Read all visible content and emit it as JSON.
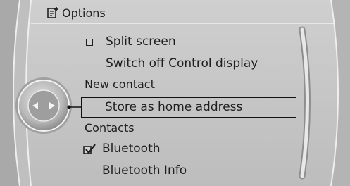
{
  "header": {
    "title": "Options",
    "icon": "options-edit-icon"
  },
  "menu": {
    "split_screen": {
      "label": "Split screen",
      "checked": false
    },
    "switch_off_display": {
      "label": "Switch off Control display"
    },
    "section_new_contact": "New contact",
    "store_home": {
      "label": "Store as home address",
      "selected": true
    },
    "section_contacts": "Contacts",
    "bluetooth": {
      "label": "Bluetooth",
      "checked": true
    },
    "bluetooth_info": {
      "label": "Bluetooth Info"
    }
  },
  "controller": {
    "left_arrow": "arrow-left-icon",
    "right_arrow": "arrow-right-icon"
  }
}
